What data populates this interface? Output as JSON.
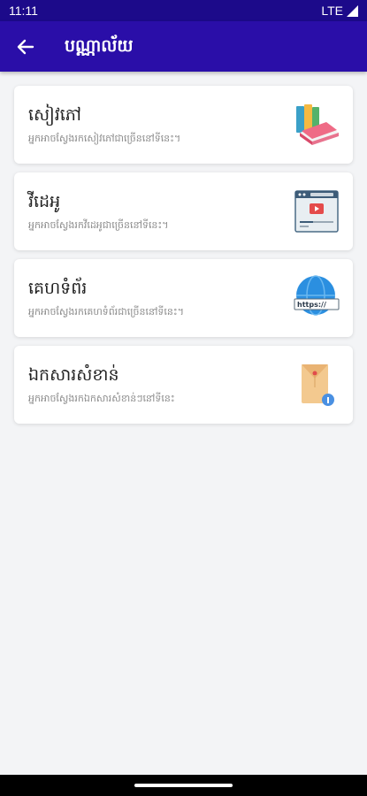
{
  "status_bar": {
    "time": "11:11",
    "network": "LTE"
  },
  "app_bar": {
    "title": "បណ្ណាល័យ",
    "back_icon": "arrow-left-icon"
  },
  "items": [
    {
      "title": "សៀវភៅ",
      "subtitle": "អ្នកអាចស្វែងរកសៀវភៅជាច្រើននៅទីនេះ។",
      "icon": "books-icon"
    },
    {
      "title": "វីដេអូ",
      "subtitle": "អ្នកអាចស្វែងរកវីដេអូជាច្រើននៅទីនេះ។",
      "icon": "video-player-icon"
    },
    {
      "title": "គេហទំព័រ",
      "subtitle": "អ្នកអាចស្វែងរកគេហទំព័រជាច្រើននៅទីនេះ។",
      "icon": "website-globe-icon"
    },
    {
      "title": "ឯកសារសំខាន់",
      "subtitle": "អ្នកអាចស្វែងរកឯកសារសំខាន់ៗនៅទីនេះ",
      "icon": "document-envelope-icon"
    }
  ],
  "colors": {
    "status_bar": "#1c0a8a",
    "app_bar": "#2a0ea8",
    "background": "#f3f4f6",
    "card": "#ffffff"
  }
}
